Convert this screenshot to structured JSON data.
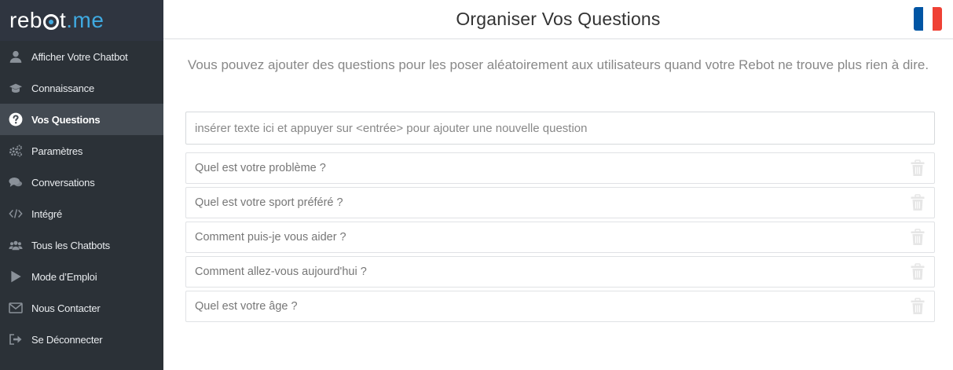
{
  "app": {
    "logo_text_main": "reb",
    "logo_text_after": "t",
    "logo_text_accent": ".me"
  },
  "sidebar": {
    "items": [
      {
        "label": "Afficher Votre Chatbot",
        "icon": "user-icon",
        "active": false
      },
      {
        "label": "Connaissance",
        "icon": "graduation-cap-icon",
        "active": false
      },
      {
        "label": "Vos Questions",
        "icon": "question-circle-icon",
        "active": true
      },
      {
        "label": "Paramètres",
        "icon": "cogs-icon",
        "active": false
      },
      {
        "label": "Conversations",
        "icon": "chat-bubbles-icon",
        "active": false
      },
      {
        "label": "Intégré",
        "icon": "code-icon",
        "active": false
      },
      {
        "label": "Tous les Chatbots",
        "icon": "users-icon",
        "active": false
      },
      {
        "label": "Mode d’Emploi",
        "icon": "play-icon",
        "active": false
      },
      {
        "label": "Nous Contacter",
        "icon": "envelope-icon",
        "active": false
      },
      {
        "label": "Se Déconnecter",
        "icon": "sign-out-icon",
        "active": false
      }
    ]
  },
  "header": {
    "title": "Organiser Vos Questions",
    "language_flag": "france-flag-icon"
  },
  "main": {
    "intro": "Vous pouvez ajouter des questions pour les poser aléatoirement aux utilisateurs quand votre Rebot ne trouve plus rien à dire.",
    "new_question": {
      "placeholder": "insérer texte ici et appuyer sur <entrée> pour ajouter une nouvelle question",
      "value": ""
    },
    "questions": [
      "Quel est votre problème ?",
      "Quel est votre sport préféré ?",
      "Comment puis-je vous aider ?",
      "Comment allez-vous aujourd'hui ?",
      "Quel est votre âge ?"
    ]
  },
  "colors": {
    "sidebar_bg": "#2b3137",
    "sidebar_active": "#434a52",
    "accent": "#3fa9e0",
    "flag_blue": "#0055a4",
    "flag_white": "#ffffff",
    "flag_red": "#ef4135"
  }
}
